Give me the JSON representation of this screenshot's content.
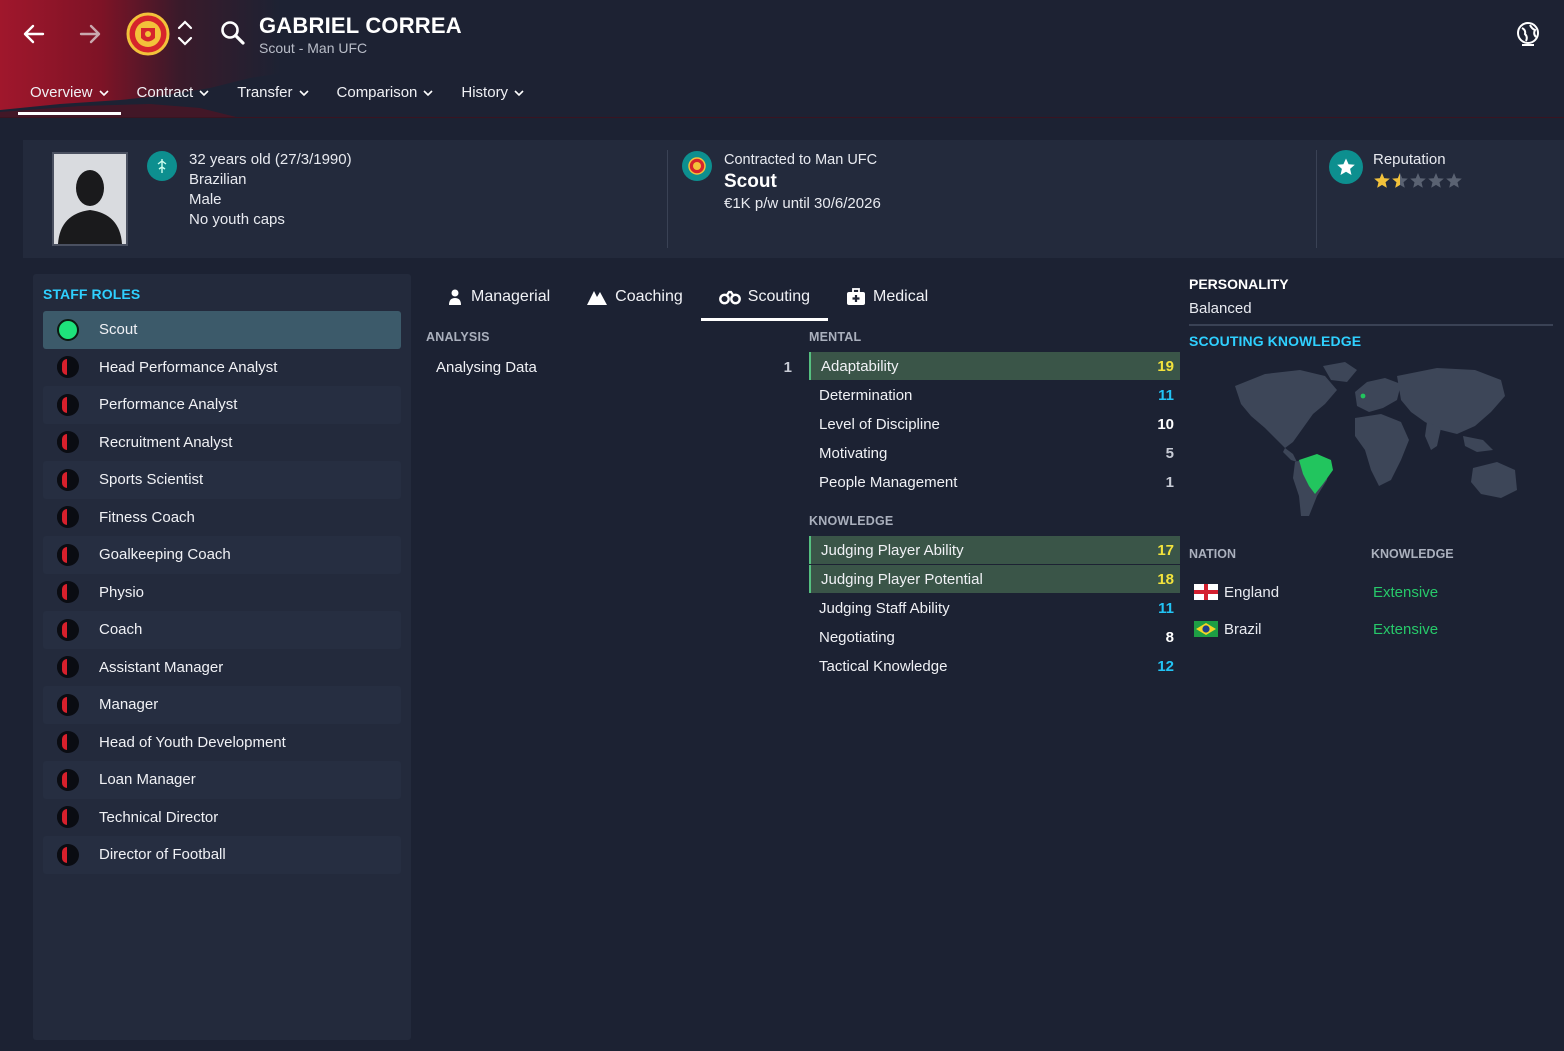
{
  "header": {
    "title": "GABRIEL CORREA",
    "subtitle": "Scout - Man UFC",
    "tabs": [
      {
        "label": "Overview",
        "active": true
      },
      {
        "label": "Contract"
      },
      {
        "label": "Transfer"
      },
      {
        "label": "Comparison"
      },
      {
        "label": "History"
      }
    ],
    "accent_color": "#8c1528"
  },
  "profile": {
    "age_line": "32 years old (27/3/1990)",
    "nationality": "Brazilian",
    "gender": "Male",
    "caps": "No youth caps",
    "contract_line": "Contracted to Man UFC",
    "role": "Scout",
    "wage_line": "€1K p/w until 30/6/2026",
    "reputation_label": "Reputation",
    "reputation_stars": 1.5,
    "reputation_max": 5
  },
  "staff_roles": {
    "heading": "STAFF ROLES",
    "items": [
      {
        "label": "Scout",
        "selected": true
      },
      {
        "label": "Head Performance Analyst"
      },
      {
        "label": "Performance Analyst"
      },
      {
        "label": "Recruitment Analyst"
      },
      {
        "label": "Sports Scientist"
      },
      {
        "label": "Fitness Coach"
      },
      {
        "label": "Goalkeeping Coach"
      },
      {
        "label": "Physio"
      },
      {
        "label": "Coach"
      },
      {
        "label": "Assistant Manager"
      },
      {
        "label": "Manager"
      },
      {
        "label": "Head of Youth Development"
      },
      {
        "label": "Loan Manager"
      },
      {
        "label": "Technical Director"
      },
      {
        "label": "Director of Football"
      }
    ]
  },
  "attribute_tabs": [
    {
      "label": "Managerial",
      "icon": "person-icon"
    },
    {
      "label": "Coaching",
      "icon": "coaching-icon"
    },
    {
      "label": "Scouting",
      "icon": "binoculars-icon",
      "active": true
    },
    {
      "label": "Medical",
      "icon": "medkit-icon"
    }
  ],
  "analysis": {
    "heading": "ANALYSIS",
    "rows": [
      {
        "label": "Analysing Data",
        "value": "1"
      }
    ]
  },
  "mental": {
    "heading": "MENTAL",
    "rows": [
      {
        "label": "Adaptability",
        "value": "19",
        "color": "#f3e33c",
        "highlight": true
      },
      {
        "label": "Determination",
        "value": "11",
        "color": "#22c4f5"
      },
      {
        "label": "Level of Discipline",
        "value": "10",
        "color": "#ffffff"
      },
      {
        "label": "Motivating",
        "value": "5",
        "color": "#c8ccd6"
      },
      {
        "label": "People Management",
        "value": "1",
        "color": "#c8ccd6"
      }
    ]
  },
  "knowledge": {
    "heading": "KNOWLEDGE",
    "rows": [
      {
        "label": "Judging Player Ability",
        "value": "17",
        "color": "#f3e33c",
        "highlight": true
      },
      {
        "label": "Judging Player Potential",
        "value": "18",
        "color": "#f3e33c",
        "highlight": true
      },
      {
        "label": "Judging Staff Ability",
        "value": "11",
        "color": "#22c4f5"
      },
      {
        "label": "Negotiating",
        "value": "8",
        "color": "#ffffff"
      },
      {
        "label": "Tactical Knowledge",
        "value": "12",
        "color": "#22c4f5"
      }
    ]
  },
  "personality": {
    "heading": "PERSONALITY",
    "value": "Balanced"
  },
  "scouting_knowledge": {
    "heading": "SCOUTING KNOWLEDGE",
    "col_nation": "NATION",
    "col_knowledge": "KNOWLEDGE",
    "rows": [
      {
        "nation": "England",
        "level": "Extensive",
        "flag": "england-flag"
      },
      {
        "nation": "Brazil",
        "level": "Extensive",
        "flag": "brazil-flag"
      }
    ]
  }
}
